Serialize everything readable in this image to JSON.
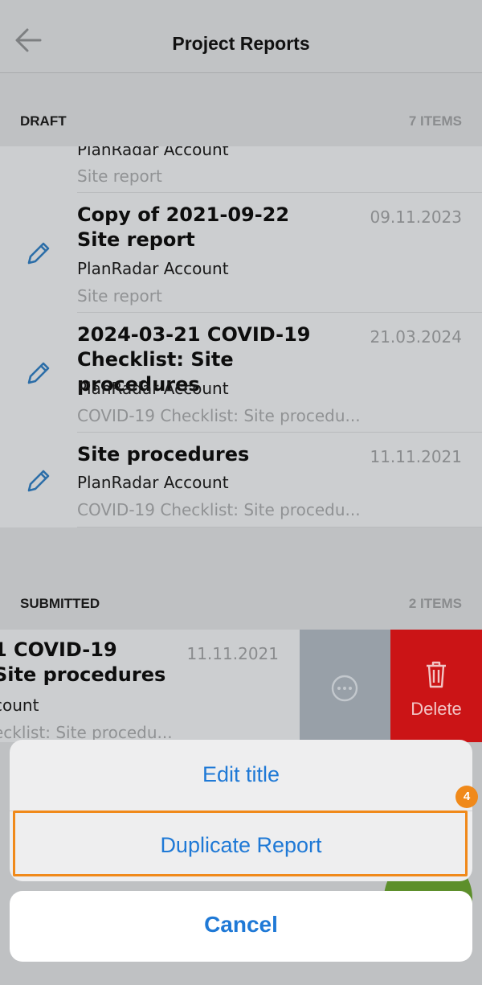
{
  "header": {
    "title": "Project Reports",
    "back_icon": "arrow-left-icon"
  },
  "draft": {
    "title": "DRAFT",
    "count": "7 ITEMS",
    "partial_row": {
      "account": "PlanRadar Account",
      "type": "Site report"
    },
    "rows": [
      {
        "title_line1": "Copy of 2021-09-22",
        "title_line2": "Site report",
        "date": "09.11.2023",
        "account": "PlanRadar Account",
        "type": "Site report"
      },
      {
        "title_line1": "2024-03-21 COVID-19",
        "title_line2": "Checklist: Site procedures",
        "date": "21.03.2024",
        "account": "PlanRadar Account",
        "type": "COVID-19 Checklist: Site procedu..."
      },
      {
        "title_line1": "Site procedures",
        "date": "11.11.2021",
        "account": "PlanRadar Account",
        "type": "COVID-19 Checklist: Site procedu..."
      }
    ]
  },
  "submitted": {
    "title": "SUBMITTED",
    "count": "2 ITEMS",
    "row": {
      "title_line1": "1 COVID-19",
      "title_line2": "Site procedures",
      "date": "11.11.2021",
      "account": "count",
      "type": "ecklist: Site procedu..."
    },
    "more_icon": "ellipsis-circle-icon",
    "delete_label": "Delete",
    "delete_icon": "trash-icon"
  },
  "action_sheet": {
    "edit_title": "Edit title",
    "duplicate": "Duplicate Report",
    "cancel": "Cancel",
    "step_badge": "4"
  },
  "colors": {
    "accent": "#1f79d6",
    "delete": "#cb1416",
    "highlight": "#f0891a",
    "fab": "#5d8f2b"
  }
}
